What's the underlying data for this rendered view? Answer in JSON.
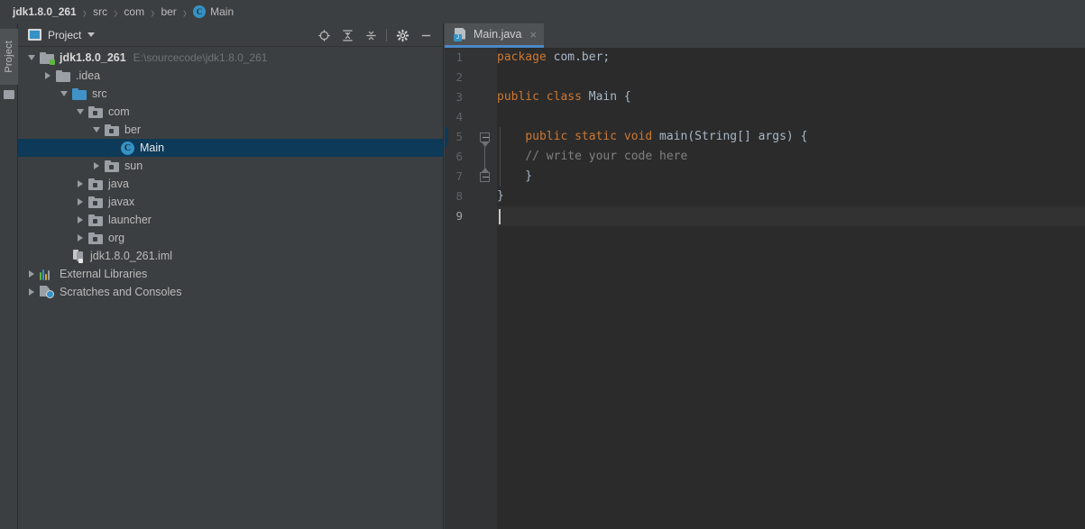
{
  "breadcrumb": {
    "items": [
      {
        "label": "jdk1.8.0_261",
        "icon": "none",
        "bold": true
      },
      {
        "label": "src",
        "icon": "none",
        "bold": false
      },
      {
        "label": "com",
        "icon": "none",
        "bold": false
      },
      {
        "label": "ber",
        "icon": "none",
        "bold": false
      },
      {
        "label": "Main",
        "icon": "class-icon",
        "bold": false
      }
    ],
    "separator": "›"
  },
  "tool_stripe": {
    "project_label": "Project"
  },
  "project_panel": {
    "title": "Project",
    "icons": {
      "project_icon": "project-icon",
      "dropdown": "chevron-down-icon",
      "locate": "locate-icon",
      "expand_all": "expand-all-icon",
      "collapse_all": "collapse-all-icon",
      "settings": "gear-icon",
      "hide": "minimize-icon"
    },
    "tree": [
      {
        "label": "jdk1.8.0_261",
        "sub": "E:\\sourcecode\\jdk1.8.0_261",
        "icon": "module-folder-icon",
        "indent": 0,
        "twisty": "open",
        "bold": true,
        "selected": false
      },
      {
        "label": ".idea",
        "sub": "",
        "icon": "folder-gray-icon",
        "indent": 1,
        "twisty": "closed",
        "bold": false,
        "selected": false
      },
      {
        "label": "src",
        "sub": "",
        "icon": "folder-source-icon",
        "indent": 1,
        "twisty": "open",
        "bold": false,
        "selected": false
      },
      {
        "label": "com",
        "sub": "",
        "icon": "package-icon",
        "indent": 2,
        "twisty": "open",
        "bold": false,
        "selected": false
      },
      {
        "label": "ber",
        "sub": "",
        "icon": "package-icon",
        "indent": 3,
        "twisty": "open",
        "bold": false,
        "selected": false
      },
      {
        "label": "Main",
        "sub": "",
        "icon": "class-icon",
        "indent": 4,
        "twisty": "none",
        "bold": false,
        "selected": true
      },
      {
        "label": "sun",
        "sub": "",
        "icon": "package-icon",
        "indent": 3,
        "twisty": "closed",
        "bold": false,
        "selected": false
      },
      {
        "label": "java",
        "sub": "",
        "icon": "package-icon",
        "indent": 2,
        "twisty": "closed",
        "bold": false,
        "selected": false
      },
      {
        "label": "javax",
        "sub": "",
        "icon": "package-icon",
        "indent": 2,
        "twisty": "closed",
        "bold": false,
        "selected": false
      },
      {
        "label": "launcher",
        "sub": "",
        "icon": "package-icon",
        "indent": 2,
        "twisty": "closed",
        "bold": false,
        "selected": false
      },
      {
        "label": "org",
        "sub": "",
        "icon": "package-icon",
        "indent": 2,
        "twisty": "closed",
        "bold": false,
        "selected": false
      },
      {
        "label": "jdk1.8.0_261.iml",
        "sub": "",
        "icon": "iml-file-icon",
        "indent": 2,
        "twisty": "none",
        "bold": false,
        "selected": false
      },
      {
        "label": "External Libraries",
        "sub": "",
        "icon": "external-libraries-icon",
        "indent": 0,
        "twisty": "closed",
        "bold": false,
        "selected": false
      },
      {
        "label": "Scratches and Consoles",
        "sub": "",
        "icon": "scratches-icon",
        "indent": 0,
        "twisty": "closed",
        "bold": false,
        "selected": false
      }
    ]
  },
  "editor": {
    "tab": {
      "label": "Main.java",
      "icon": "java-file-icon",
      "badge": "J",
      "close": "×",
      "active": true
    },
    "current_line": 9,
    "line_numbers": [
      1,
      2,
      3,
      4,
      5,
      6,
      7,
      8,
      9
    ],
    "fold_lines": [
      5,
      7
    ],
    "lines": [
      {
        "n": 1,
        "tokens": [
          {
            "t": "package ",
            "c": "kw"
          },
          {
            "t": "com.ber;",
            "c": "pl"
          }
        ]
      },
      {
        "n": 2,
        "tokens": []
      },
      {
        "n": 3,
        "tokens": [
          {
            "t": "public class ",
            "c": "kw"
          },
          {
            "t": "Main {",
            "c": "pl"
          }
        ]
      },
      {
        "n": 4,
        "tokens": []
      },
      {
        "n": 5,
        "tokens": [
          {
            "t": "    ",
            "c": "pl"
          },
          {
            "t": "public static void ",
            "c": "kw"
          },
          {
            "t": "main(String[] args) {",
            "c": "pl"
          }
        ]
      },
      {
        "n": 6,
        "tokens": [
          {
            "t": "    ",
            "c": "pl"
          },
          {
            "t": "// write your code here",
            "c": "cm"
          }
        ]
      },
      {
        "n": 7,
        "tokens": [
          {
            "t": "    }",
            "c": "pl"
          }
        ]
      },
      {
        "n": 8,
        "tokens": [
          {
            "t": "}",
            "c": "pl"
          }
        ]
      },
      {
        "n": 9,
        "tokens": []
      }
    ],
    "colors": {
      "background": "#2b2b2b",
      "gutter": "#313335",
      "keyword": "#cc7832",
      "plain": "#a9b7c6",
      "comment": "#808080",
      "current_line": "#323232",
      "selection": "#0d3a58",
      "tab_underline": "#4a88c7"
    }
  }
}
